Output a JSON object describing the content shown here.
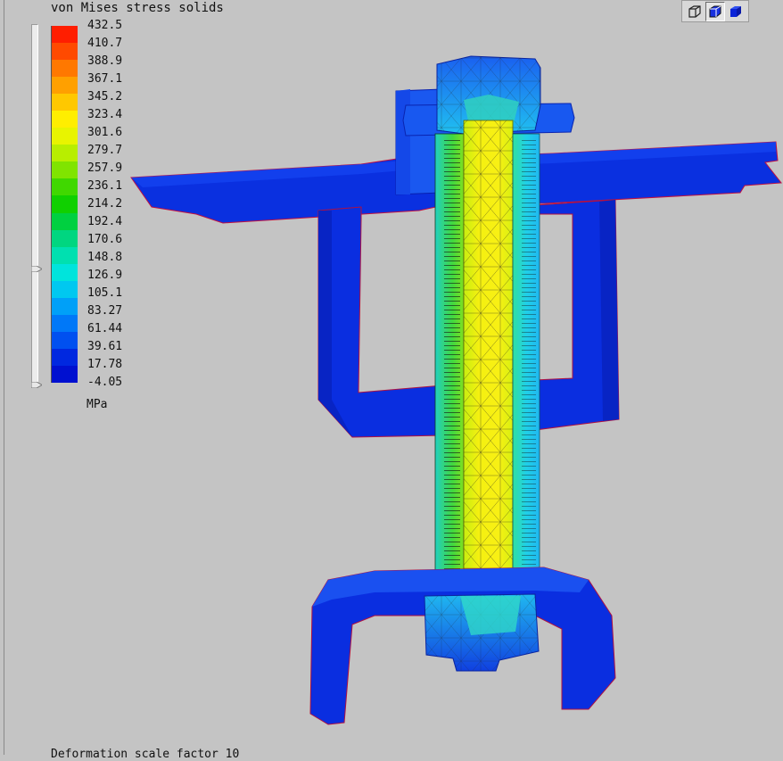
{
  "legend": {
    "title": "von Mises stress solids",
    "units": "MPa",
    "ticks": [
      "432.5",
      "410.7",
      "388.9",
      "367.1",
      "345.2",
      "323.4",
      "301.6",
      "279.7",
      "257.9",
      "236.1",
      "214.2",
      "192.4",
      "170.6",
      "148.8",
      "126.9",
      "105.1",
      "83.27",
      "61.44",
      "39.61",
      "17.78",
      "-4.05"
    ],
    "colors": [
      "#ff1e00",
      "#ff4a00",
      "#ff7800",
      "#ffa000",
      "#ffc800",
      "#ffee00",
      "#e8f400",
      "#b8ee00",
      "#80e400",
      "#40d800",
      "#10d000",
      "#00d040",
      "#00d680",
      "#00e0b0",
      "#00e4dc",
      "#00c8f0",
      "#00a0f8",
      "#0078f8",
      "#0050f0",
      "#0028e0",
      "#0010d0"
    ]
  },
  "view_toolbar": {
    "buttons": [
      {
        "name": "wireframe-view-icon",
        "active": false
      },
      {
        "name": "hidden-line-view-icon",
        "active": true
      },
      {
        "name": "shaded-view-icon",
        "active": false
      }
    ]
  },
  "footer": {
    "text": "Deformation scale factor 10"
  },
  "model": {
    "colors": {
      "low": "#0a2ee0",
      "low_dark": "#0820b8",
      "edge": "#d0103a",
      "cyan": "#20d8e8",
      "green": "#3cd83c",
      "yellow": "#f0ee10",
      "light_blue": "#30a8f8"
    }
  }
}
